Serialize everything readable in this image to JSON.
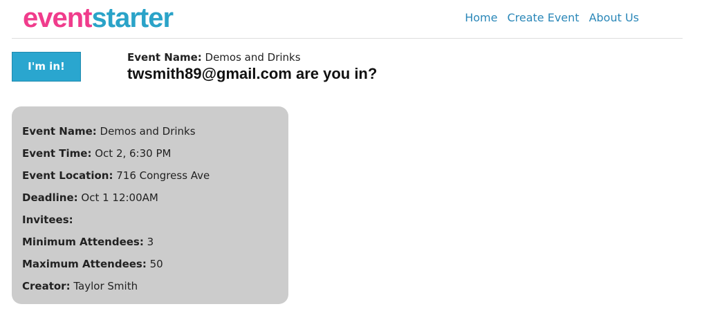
{
  "header": {
    "logo": {
      "part1": "event",
      "part2": "starter"
    },
    "nav": [
      {
        "label": "Home"
      },
      {
        "label": "Create Event"
      },
      {
        "label": "About Us"
      }
    ]
  },
  "action": {
    "button_label": "I'm in!"
  },
  "prompt": {
    "event_name_label": "Event Name:",
    "event_name_value": "Demos and Drinks",
    "question": "twsmith89@gmail.com are you in?"
  },
  "details": [
    {
      "label": "Event Name:",
      "value": "Demos and Drinks"
    },
    {
      "label": "Event Time:",
      "value": "Oct 2, 6:30 PM"
    },
    {
      "label": "Event Location:",
      "value": "716 Congress Ave"
    },
    {
      "label": "Deadline:",
      "value": "Oct 1 12:00AM"
    },
    {
      "label": "Invitees:",
      "value": ""
    },
    {
      "label": "Minimum Attendees:",
      "value": "3"
    },
    {
      "label": "Maximum Attendees:",
      "value": "50"
    },
    {
      "label": "Creator:",
      "value": "Taylor Smith"
    }
  ],
  "colors": {
    "logo_pink": "#f03c8c",
    "logo_blue": "#2aa3c8",
    "nav_link": "#2a87b8",
    "button_bg": "#2aa6cf",
    "card_bg": "#cccccc"
  }
}
